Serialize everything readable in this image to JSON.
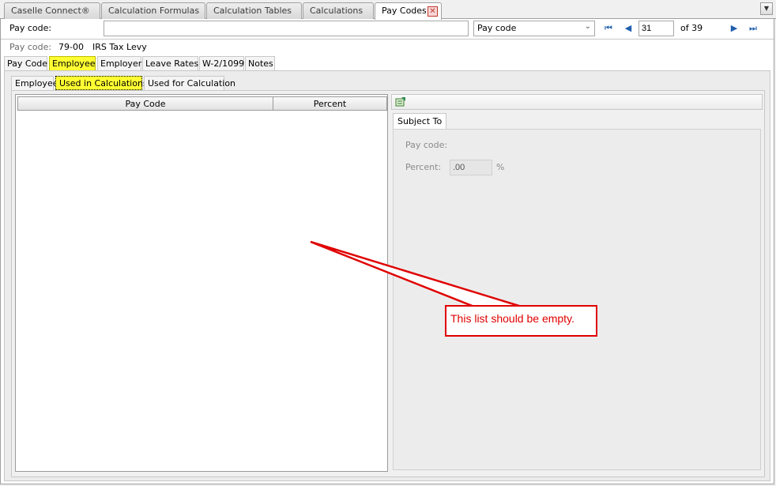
{
  "doc_tabs": [
    {
      "label": "Caselle Connect®"
    },
    {
      "label": "Calculation Formulas"
    },
    {
      "label": "Calculation Tables"
    },
    {
      "label": "Calculations"
    },
    {
      "label": "Pay Codes"
    }
  ],
  "nav": {
    "label": "Pay code:",
    "input_value": "",
    "lookup_select": "Pay code",
    "record_number": "31",
    "record_total": "of 39"
  },
  "info": {
    "label": "Pay code:",
    "code": "79-00",
    "name": "IRS Tax Levy"
  },
  "record_tabs": [
    "Pay Code",
    "Employee",
    "Employer",
    "Leave Rates",
    "W-2/1099",
    "Notes"
  ],
  "sub_tabs": [
    "Employee",
    "Used in Calculations",
    "Used for Calculation"
  ],
  "grid": {
    "columns": [
      "Pay Code",
      "Percent"
    ],
    "rows": []
  },
  "detail": {
    "tab": "Subject To",
    "paycode_label": "Pay code:",
    "percent_label": "Percent:",
    "percent_value": ".00",
    "percent_unit": "%"
  },
  "annotation": {
    "text": "This list should be empty."
  },
  "colors": {
    "highlight": "#ffff33",
    "annotation": "#e00000",
    "nav_icon": "#1f5fae"
  }
}
